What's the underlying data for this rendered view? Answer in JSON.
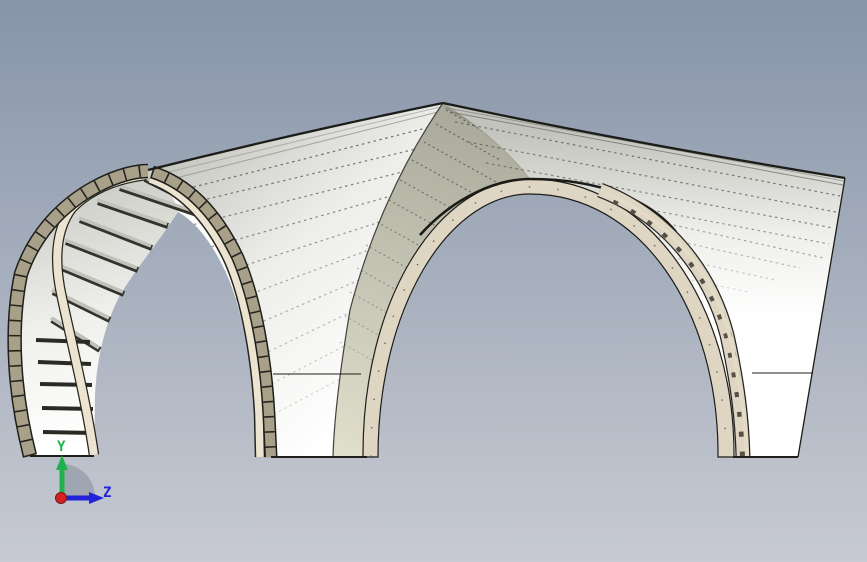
{
  "viewport": {
    "background": {
      "top_color": "#8795a9",
      "bottom_color": "#c7cad2"
    },
    "model": {
      "name": "cross-vault-arch-structure",
      "palette": {
        "rib_tan": "#a8a089",
        "rib_cream": "#e9e1cd",
        "band_cream": "#ded6c2",
        "panel_white": "#fdfdfc",
        "roof_gray": "#c9c9c3",
        "sail_green": "#dcdbc7",
        "slat_gray": "#bdbdb5",
        "edge_dark": "#1e1e1a"
      }
    },
    "axis_triad": {
      "y_label": "Y",
      "z_label": "Z",
      "y_color": "#1fb24c",
      "z_color": "#2222d8",
      "origin_color": "#d42222",
      "fan_color": "#9aa1ab"
    }
  }
}
